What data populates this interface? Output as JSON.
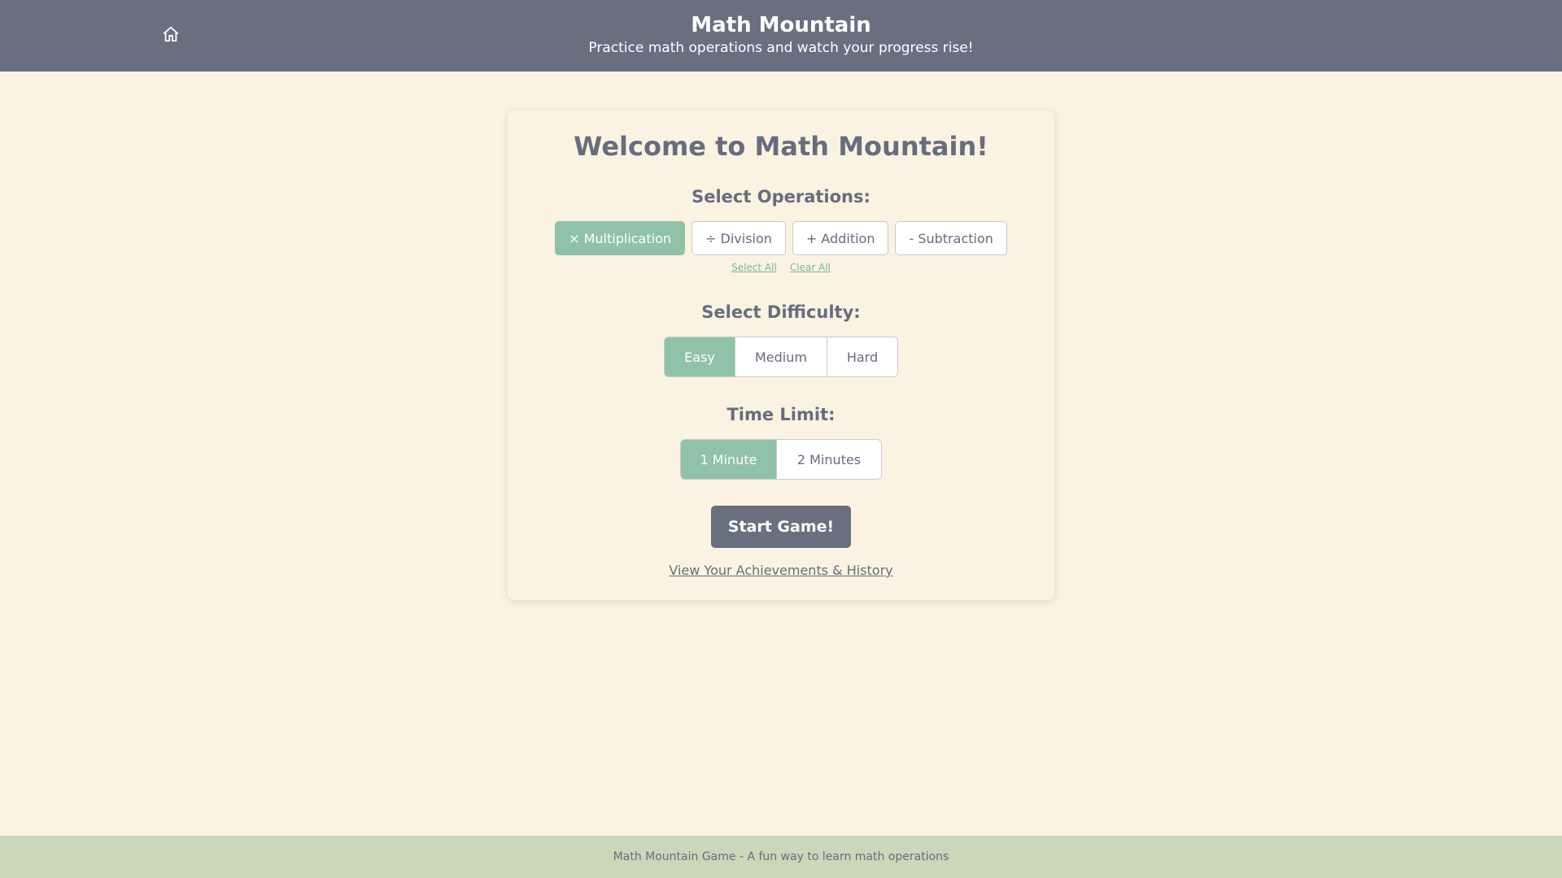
{
  "header": {
    "title": "Math Mountain",
    "subtitle": "Practice math operations and watch your progress rise!",
    "home_icon": "home-icon"
  },
  "card": {
    "welcome": "Welcome to Math Mountain!",
    "operations": {
      "label": "Select Operations:",
      "items": [
        {
          "label": "× Multiplication",
          "selected": true
        },
        {
          "label": "÷ Division",
          "selected": false
        },
        {
          "label": "+ Addition",
          "selected": false
        },
        {
          "label": "- Subtraction",
          "selected": false
        }
      ],
      "select_all": "Select All",
      "clear_all": "Clear All"
    },
    "difficulty": {
      "label": "Select Difficulty:",
      "options": [
        {
          "label": "Easy",
          "selected": true
        },
        {
          "label": "Medium",
          "selected": false
        },
        {
          "label": "Hard",
          "selected": false
        }
      ]
    },
    "time_limit": {
      "label": "Time Limit:",
      "options": [
        {
          "label": "1 Minute",
          "selected": true
        },
        {
          "label": "2 Minutes",
          "selected": false
        }
      ]
    },
    "start_button": "Start Game!",
    "history_link": "View Your Achievements & History"
  },
  "footer": {
    "text": "Math Mountain Game - A fun way to learn math operations"
  },
  "colors": {
    "header_bg": "#6a6f80",
    "page_bg": "#faf3e1",
    "accent": "#8fc2a7",
    "footer_bg": "#c9d8b9",
    "text": "#676d7e"
  }
}
